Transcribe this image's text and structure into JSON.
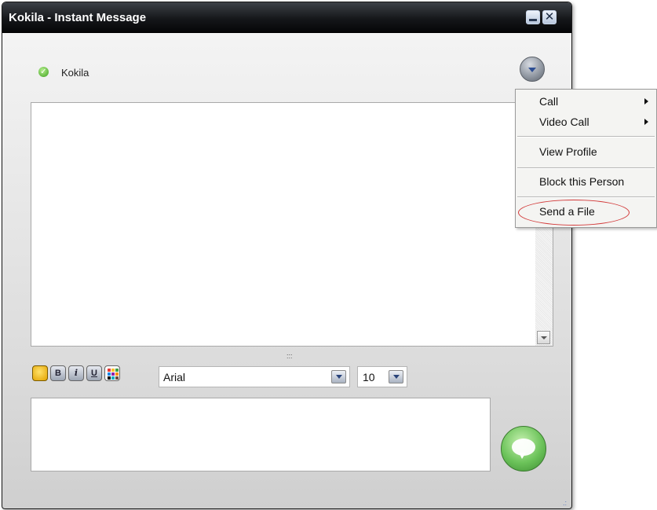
{
  "window": {
    "title": "Kokila - Instant Message"
  },
  "titlebar_buttons": {
    "minimize_icon": "minimize-icon",
    "close_symbol": "✕"
  },
  "contact": {
    "name": "Kokila",
    "status_icon": "online-check-icon",
    "status_glyph": "✓",
    "status_color": "#3c9f1d"
  },
  "toolbar": {
    "emoticon_icon": "smiley-icon",
    "bold_label": "B",
    "italic_label": "i",
    "underline_label": "U",
    "color_icon": "color-palette-icon",
    "font": {
      "selected": "Arial"
    },
    "size": {
      "selected": "10"
    }
  },
  "resize_handle": ":::",
  "resize_corner": ".:",
  "send_button_icon": "speech-bubble-icon",
  "context_menu": {
    "items": [
      {
        "label": "Call",
        "has_submenu": true
      },
      {
        "label": "Video Call",
        "has_submenu": true
      },
      {
        "label": "View Profile",
        "has_submenu": false
      },
      {
        "label": "Block this Person",
        "has_submenu": false
      },
      {
        "label": "Send a File",
        "has_submenu": false,
        "highlighted": true
      }
    ],
    "highlight_color": "#d23a3a"
  },
  "colors": {
    "titlebar": "#15171a",
    "window_bg": "#e4e4e4",
    "send_button": "#6cc35a"
  }
}
